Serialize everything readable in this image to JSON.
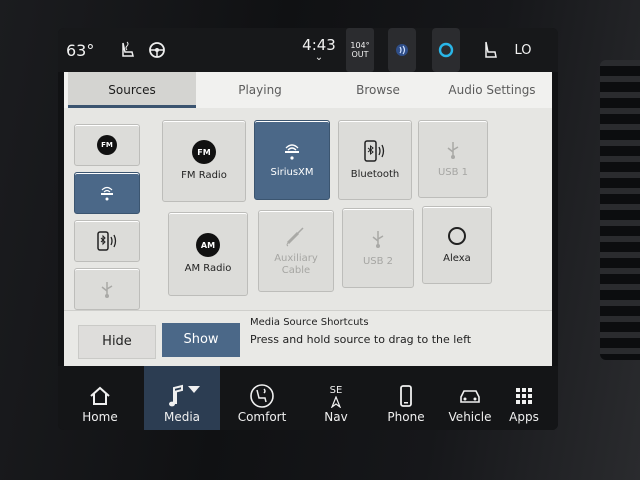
{
  "status": {
    "temperature": "63°",
    "time": "4:43",
    "time_chevron": "⌄",
    "outside_temp_value": "104°",
    "outside_temp_label": "OUT",
    "fan_level": "LO",
    "icons": [
      "heated-seat-icon",
      "heated-wheel-icon",
      "voice-command-icon",
      "alexa-icon",
      "seat-icon"
    ]
  },
  "tabs": [
    {
      "label": "Sources",
      "active": true
    },
    {
      "label": "Playing",
      "active": false
    },
    {
      "label": "Browse",
      "active": false
    },
    {
      "label": "Audio Settings",
      "active": false
    }
  ],
  "shortcuts": {
    "fm_badge": "FM",
    "items": [
      "fm-shortcut",
      "siriusxm-shortcut",
      "bluetooth-shortcut",
      "usb-shortcut"
    ]
  },
  "sources": {
    "fm": {
      "label": "FM Radio",
      "badge": "FM"
    },
    "siriusxm": {
      "label": "SiriusXM"
    },
    "bluetooth": {
      "label": "Bluetooth"
    },
    "usb1": {
      "label": "USB 1"
    },
    "am": {
      "label": "AM Radio",
      "badge": "AM"
    },
    "aux": {
      "label": "Auxiliary Cable"
    },
    "usb2": {
      "label": "USB 2"
    },
    "alexa": {
      "label": "Alexa"
    }
  },
  "shortcut_bar": {
    "hide_label": "Hide",
    "show_label": "Show",
    "title": "Media Source Shortcuts",
    "subtitle": "Press and hold source to drag to the left"
  },
  "nav": [
    {
      "label": "Home",
      "icon": "home-icon"
    },
    {
      "label": "Media",
      "icon": "music-note-icon",
      "active": true
    },
    {
      "label": "Comfort",
      "icon": "comfort-icon"
    },
    {
      "label": "Nav",
      "icon": "compass-icon",
      "heading": "SE"
    },
    {
      "label": "Phone",
      "icon": "phone-icon"
    },
    {
      "label": "Vehicle",
      "icon": "vehicle-icon"
    },
    {
      "label": "Apps",
      "icon": "apps-grid-icon"
    }
  ],
  "colors": {
    "accent": "#4b6888",
    "active_nav": "#2c3d52"
  }
}
